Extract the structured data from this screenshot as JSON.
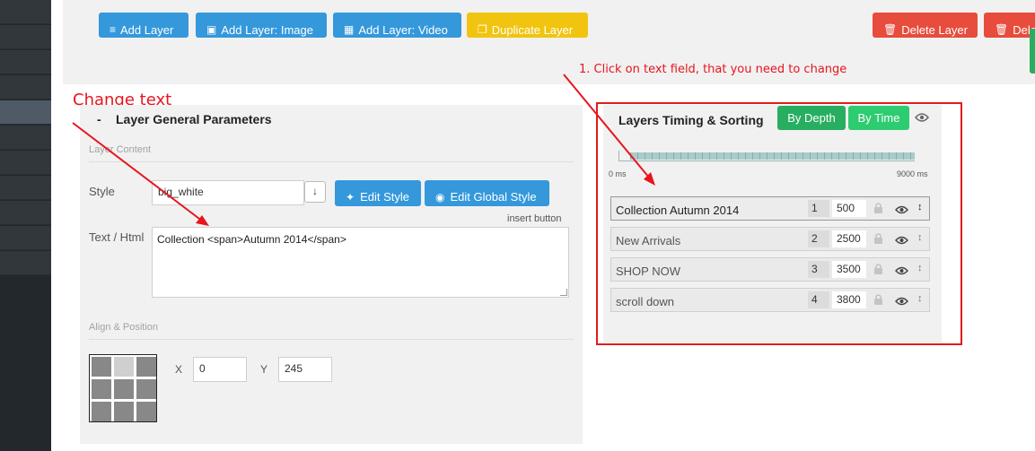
{
  "toolbar": {
    "buttons": [
      {
        "label": "Add Layer",
        "icon": "layers-icon",
        "color": "#3498db"
      },
      {
        "label": "Add Layer: Image",
        "icon": "image-icon",
        "color": "#3498db"
      },
      {
        "label": "Add Layer: Video",
        "icon": "film-icon",
        "color": "#3498db"
      },
      {
        "label": "Duplicate Layer",
        "icon": "copy-icon",
        "color": "#f1c40f"
      },
      {
        "label": "Delete Layer",
        "icon": "trash-icon",
        "color": "#e74c3c"
      },
      {
        "label": "Dele",
        "icon": "trash-icon",
        "color": "#e74c3c"
      }
    ]
  },
  "annotations": {
    "change_text": "Change text",
    "step1": "1. Click on text field, that you need to change",
    "color": "#e8141e"
  },
  "general": {
    "title_dash": "-",
    "title": "Layer General Parameters",
    "content_section": "Layer Content",
    "style_label": "Style",
    "style_value": "big_white",
    "edit_style": "Edit Style",
    "edit_global_style": "Edit Global Style",
    "insert_button": "insert button",
    "text_label": "Text / Html",
    "text_value": "Collection <span>Autumn 2014</span>",
    "align_section": "Align & Position",
    "x_label": "X",
    "x_value": "0",
    "y_label": "Y",
    "y_value": "245"
  },
  "timing": {
    "title": "Layers Timing & Sorting",
    "by_depth": "By Depth",
    "by_time": "By Time",
    "accent": "#27ae60",
    "start_label": "0 ms",
    "end_label": "9000 ms",
    "layers": [
      {
        "name": "Collection Autumn 2014",
        "depth": "1",
        "time": "500"
      },
      {
        "name": "New Arrivals",
        "depth": "2",
        "time": "2500"
      },
      {
        "name": "SHOP NOW",
        "depth": "3",
        "time": "3500"
      },
      {
        "name": "scroll down",
        "depth": "4",
        "time": "3800"
      }
    ]
  }
}
